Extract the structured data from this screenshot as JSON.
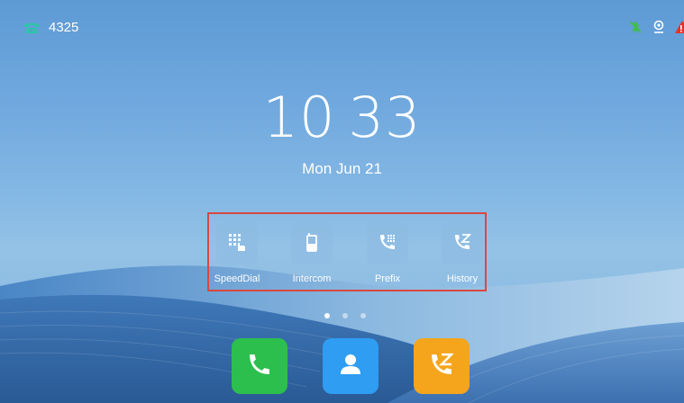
{
  "status": {
    "extension": "4325",
    "icons": [
      "bluetooth-off-icon",
      "voicemail-location-icon",
      "warning-icon"
    ]
  },
  "clock": {
    "hours": "10",
    "minutes": "33",
    "date": "Mon Jun 21"
  },
  "apps": [
    {
      "label": "SpeedDial",
      "icon": "speed-dial-icon"
    },
    {
      "label": "Intercom",
      "icon": "intercom-icon"
    },
    {
      "label": "Prefix",
      "icon": "prefix-icon"
    },
    {
      "label": "History",
      "icon": "history-icon"
    }
  ],
  "pager": {
    "pages": 3,
    "active": 1
  },
  "dock": [
    {
      "name": "phone",
      "icon": "phone-icon",
      "color": "#2dbf4e"
    },
    {
      "name": "contacts",
      "icon": "contact-icon",
      "color": "#2e9df2"
    },
    {
      "name": "history",
      "icon": "history-icon",
      "color": "#f5a51c"
    }
  ],
  "colors": {
    "extension_icon": "#2fc5a8",
    "highlight_frame": "#d9483f"
  }
}
